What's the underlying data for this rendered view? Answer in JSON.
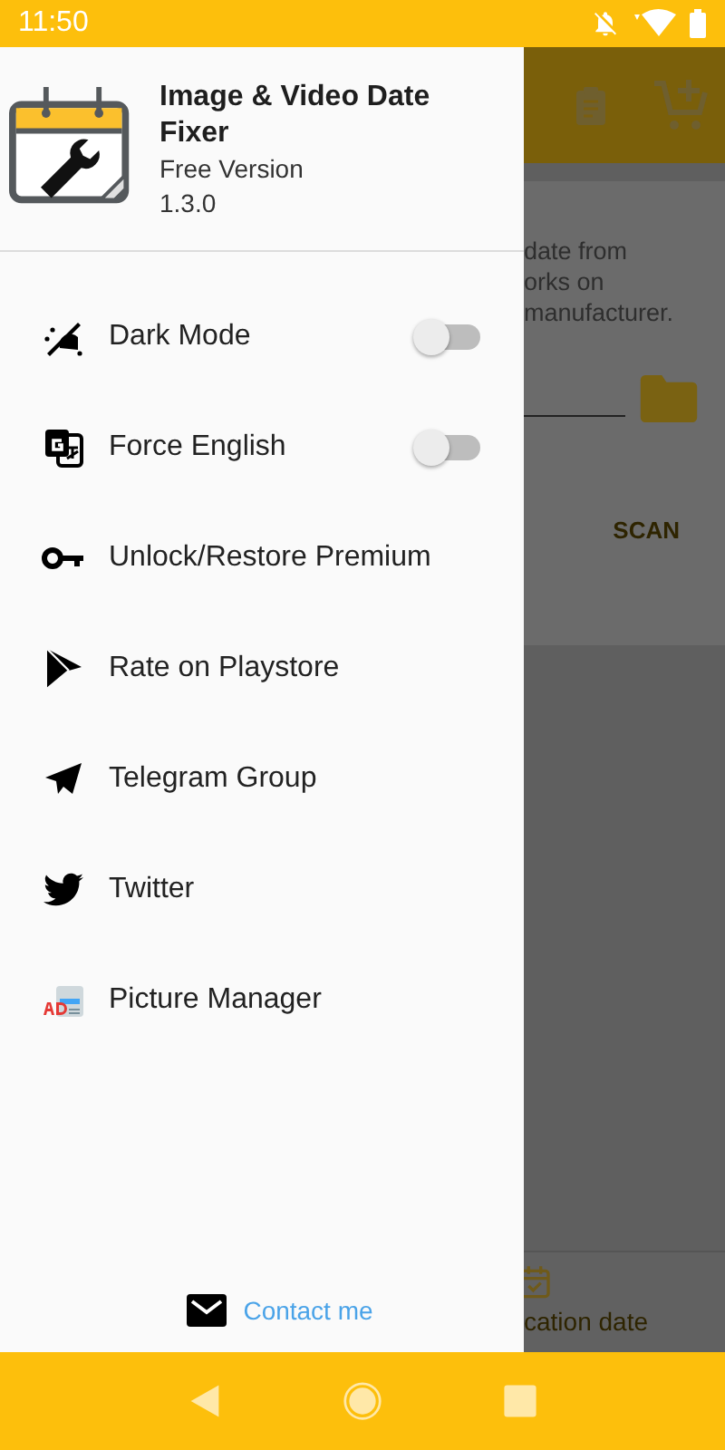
{
  "status_bar": {
    "time": "11:50"
  },
  "drawer": {
    "app_name": "Image & Video Date Fixer",
    "edition": "Free Version",
    "version": "1.3.0",
    "items": [
      {
        "label": "Dark Mode",
        "kind": "toggle",
        "on": false
      },
      {
        "label": "Force English",
        "kind": "toggle",
        "on": false
      },
      {
        "label": "Unlock/Restore Premium",
        "kind": "link"
      },
      {
        "label": "Rate on Playstore",
        "kind": "link"
      },
      {
        "label": "Telegram Group",
        "kind": "link"
      },
      {
        "label": "Twitter",
        "kind": "link"
      },
      {
        "label": "Picture Manager",
        "kind": "link"
      }
    ],
    "footer_link": "Contact me"
  },
  "background": {
    "description_lines": [
      "date from",
      "orks on",
      "manufacturer."
    ],
    "scan_button": "SCAN",
    "bottom_tab": "cation date"
  }
}
